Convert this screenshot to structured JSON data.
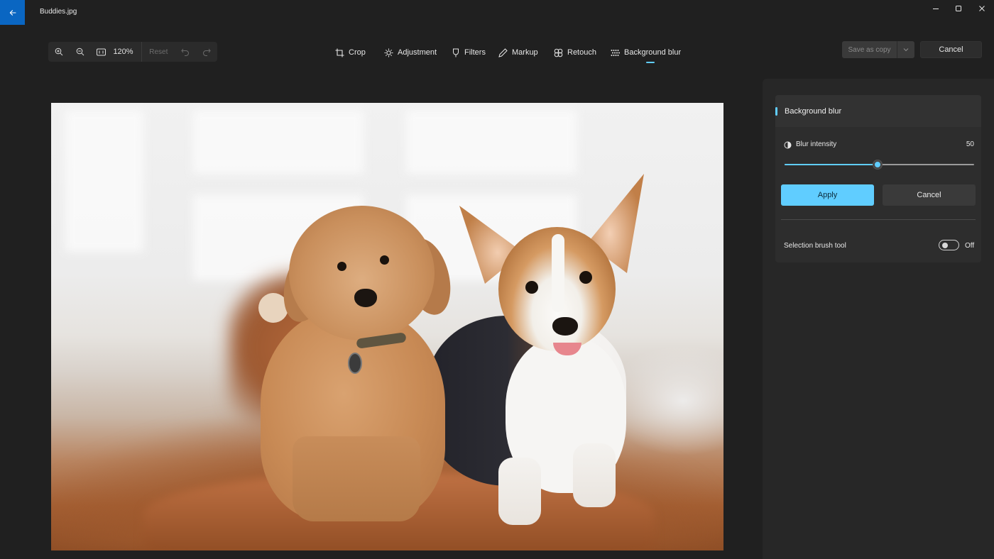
{
  "window": {
    "title": "Buddies.jpg"
  },
  "zoom": {
    "percent": "120%",
    "reset_label": "Reset"
  },
  "tools": [
    {
      "label": "Crop",
      "icon": "crop-icon"
    },
    {
      "label": "Adjustment",
      "icon": "brightness-icon"
    },
    {
      "label": "Filters",
      "icon": "filter-icon"
    },
    {
      "label": "Markup",
      "icon": "pen-icon"
    },
    {
      "label": "Retouch",
      "icon": "retouch-icon"
    },
    {
      "label": "Background blur",
      "icon": "background-blur-icon"
    }
  ],
  "active_tool": "Background blur",
  "actions": {
    "save_label": "Save as copy",
    "cancel_label": "Cancel"
  },
  "panel": {
    "title": "Background blur",
    "blur_intensity_label": "Blur intensity",
    "blur_intensity_value": "50",
    "blur_intensity_fraction": 0.49,
    "apply_label": "Apply",
    "cancel_label": "Cancel",
    "brush_label": "Selection brush tool",
    "brush_state": "Off"
  },
  "colors": {
    "accent": "#60cdff",
    "back_button": "#0a66c2",
    "background": "#202020"
  }
}
